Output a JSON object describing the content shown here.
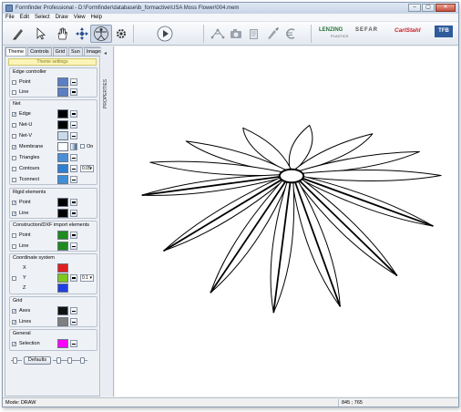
{
  "window": {
    "title": "Formfinder Professional - D:\\Formfinder\\database\\ib_formactive\\USA Moss Flower\\004.mem",
    "minimize": "–",
    "maximize": "▢",
    "close": "✕"
  },
  "menu": [
    "File",
    "Edit",
    "Select",
    "Draw",
    "View",
    "Help"
  ],
  "toolbar": {
    "tools": [
      "pen-tool-icon",
      "select-pointer-icon",
      "hand-tool-icon",
      "move-node-icon",
      "vitruvian-man-icon",
      "gear-icon",
      "play-icon",
      "network-icon",
      "camera-icon",
      "book-icon",
      "clean-icon",
      "euro-icon"
    ],
    "logos": {
      "lenzing": "LENZING",
      "lenzing_sub": "PLASTICS",
      "sefar": "SEFAR",
      "carlstahl": "CarlStahl",
      "tfb": "TFB"
    }
  },
  "panel": {
    "tabs": [
      "Theme",
      "Controls",
      "Grid",
      "Sun",
      "Images"
    ],
    "active_tab": "Theme",
    "theme_settings_label": "Theme settings",
    "groups": {
      "edge_controller": {
        "title": "Edge controller",
        "rows": [
          {
            "label": "Point",
            "checked": false,
            "color": "#5b7fc2"
          },
          {
            "label": "Line",
            "checked": false,
            "color": "#5b7fc2"
          }
        ]
      },
      "net": {
        "title": "Net",
        "rows": [
          {
            "label": "Edge",
            "checked": true,
            "color": "#000000"
          },
          {
            "label": "Net-U",
            "checked": false,
            "color": "#000000"
          },
          {
            "label": "Net-V",
            "checked": false,
            "color": "#c9d9e8"
          },
          {
            "label": "Membrane",
            "checked": true,
            "color": "#ffffff",
            "extra": "On"
          },
          {
            "label": "Triangles",
            "checked": false,
            "color": "#4b8fd6"
          },
          {
            "label": "Contours",
            "checked": false,
            "color": "#2f7fd1",
            "select": "0.05"
          },
          {
            "label": "Tconnect",
            "checked": false,
            "color": "#3f8fd8"
          }
        ]
      },
      "rigid": {
        "title": "Rigid elements",
        "rows": [
          {
            "label": "Point",
            "checked": true,
            "color": "#000000"
          },
          {
            "label": "Line",
            "checked": true,
            "color": "#000000"
          }
        ]
      },
      "construction": {
        "title": "Construction/DXF import elements",
        "rows": [
          {
            "label": "Point",
            "checked": false,
            "color": "#1f8a1f"
          },
          {
            "label": "Line",
            "checked": false,
            "color": "#1f8a1f"
          }
        ]
      },
      "coordinate": {
        "title": "Coordinate system",
        "rows": [
          {
            "label": "X",
            "color": "#e02020"
          },
          {
            "label": "Y",
            "color": "#7fc81e",
            "select": "0.1"
          },
          {
            "label": "Z",
            "color": "#1f3fe0"
          }
        ]
      },
      "grid": {
        "title": "Grid",
        "rows": [
          {
            "label": "Axes",
            "checked": true,
            "color": "#111111"
          },
          {
            "label": "Lines",
            "checked": true,
            "color": "#808080"
          }
        ]
      },
      "general": {
        "title": "General",
        "rows": [
          {
            "label": "Selection",
            "checked": true,
            "color": "#ff00ff"
          }
        ]
      }
    },
    "defaults_label": "Defaults"
  },
  "properties_label": "PROPERTIES",
  "status": {
    "mode": "Mode: DRAW",
    "coords": "845 ; 765"
  }
}
